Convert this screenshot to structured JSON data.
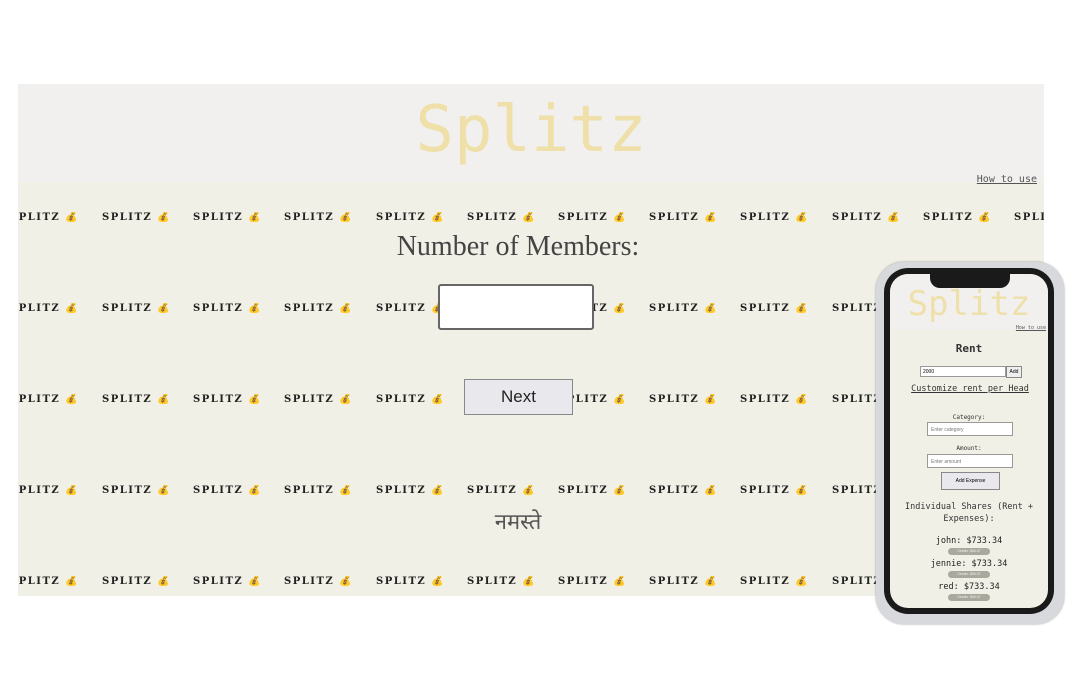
{
  "desktop": {
    "title": "Splitz",
    "how_to_link": "How to use",
    "pattern_token": "SPLITZ 💰",
    "members_label": "Number of Members:",
    "members_input_value": "",
    "next_button": "Next",
    "greeting": "नमस्ते"
  },
  "mobile": {
    "title": "Splitz",
    "how_to_link": "How to use",
    "rent_title": "Rent",
    "rent_input_value": "2000",
    "rent_add_button": "Add",
    "customize_link": "Customize rent per Head",
    "category_label": "Category:",
    "category_placeholder": "Enter category",
    "amount_label": "Amount:",
    "amount_placeholder": "Enter amount",
    "add_expense_button": "Add Expense",
    "shares_title": "Individual Shares (Rent + Expenses):",
    "shares": [
      {
        "text": "john: $733.34",
        "pill": "Details: $66.67"
      },
      {
        "text": "jennie: $733.34",
        "pill": "Details: $66.67"
      },
      {
        "text": "red: $733.34",
        "pill": "Details: $66.67"
      }
    ]
  },
  "colors": {
    "title_accent": "#efe0aa",
    "page_background": "#f0f0e6",
    "header_background": "#f1f0ee"
  }
}
